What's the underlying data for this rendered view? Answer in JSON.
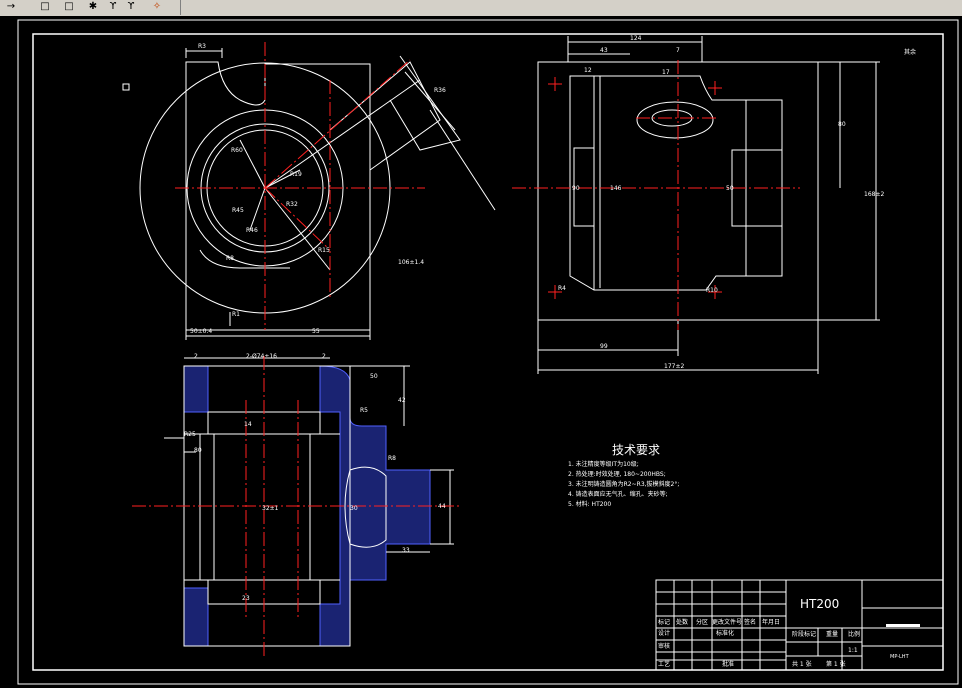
{
  "toolbar": {
    "buttons": [
      {
        "name": "arrow-icon",
        "glyph": "→"
      },
      {
        "name": "square-icon",
        "glyph": "□"
      },
      {
        "name": "square2-icon",
        "glyph": "□"
      },
      {
        "name": "gear-icon",
        "glyph": "✱"
      },
      {
        "name": "curve-icon",
        "glyph": "ϒ"
      },
      {
        "name": "curve2-icon",
        "glyph": "ϒ"
      },
      {
        "name": "tool-icon",
        "glyph": "✧"
      }
    ]
  },
  "drawing": {
    "colors": {
      "frame": "#ffffff",
      "center": "#ff2020",
      "hatch": "#5060ff",
      "dim": "#ffffff",
      "bg": "#000000"
    },
    "tech_title": "技术要求",
    "tech_items": [
      "1.   未注精度等级IT为10级;",
      "2.   热处理:时效处理, 180~200HBS;",
      "3.   未注明铸造圆角为R2~R3,拔模斜度2°;",
      "4.   铸造表面应无气孔、缩孔、夹砂等;",
      "5.   材料: HT200"
    ],
    "title_block": {
      "material": "HT200",
      "scale": "1:1",
      "sheet_total": "共 1 张",
      "sheet_no": "第 1 张",
      "code": "MP-LHT",
      "row1": [
        "标记",
        "处数",
        "分区",
        "更改文件号",
        "签名",
        "年月日"
      ],
      "row2": [
        "设计",
        "",
        "",
        "标准化"
      ],
      "row3": [
        "审核"
      ],
      "row4": [
        "工艺",
        "",
        "批准"
      ],
      "cols": [
        "阶段标记",
        "重量",
        "比例"
      ]
    },
    "dims_front": [
      "R3",
      "55",
      "50±0.4",
      "R1",
      "R60",
      "R45",
      "R46",
      "R32",
      "R19",
      "R8",
      "R15",
      "106±1.4",
      "R36"
    ],
    "dims_side": [
      "124",
      "43",
      "7",
      "12",
      "17",
      "80",
      "146",
      "50",
      "168±2",
      "R4",
      "R10",
      "99",
      "177±2",
      "90"
    ],
    "dims_section": [
      "2",
      "2-Ø74±16",
      "2",
      "50",
      "R5",
      "42",
      "14",
      "R8",
      "80",
      "44",
      "30",
      "33",
      "R25",
      "32±1",
      "23"
    ],
    "roughness_label": "其余"
  }
}
